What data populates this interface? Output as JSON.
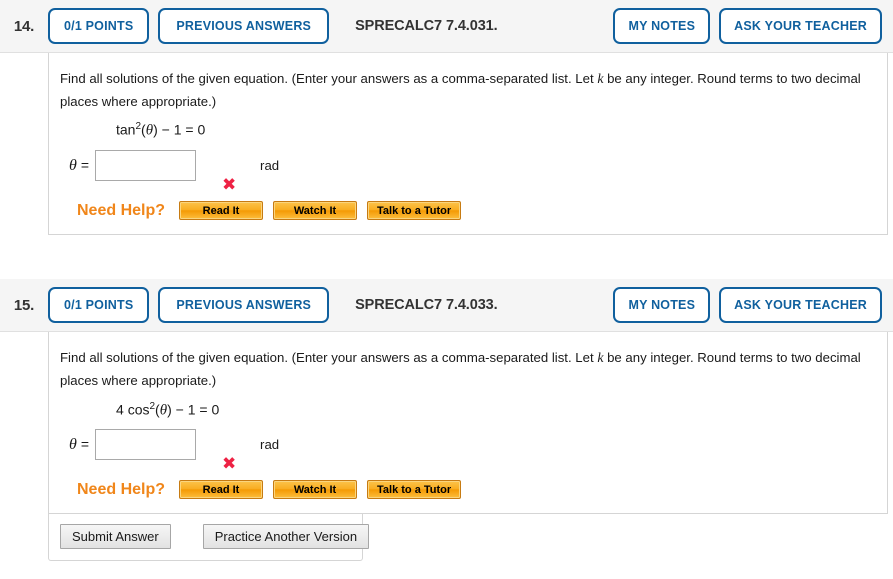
{
  "questions": [
    {
      "number": "14.",
      "points_label": "0/1 POINTS",
      "previous_answers_label": "PREVIOUS ANSWERS",
      "code": "SPRECALC7 7.4.031.",
      "my_notes_label": "MY NOTES",
      "ask_teacher_label": "ASK YOUR TEACHER",
      "prompt_part1": "Find all solutions of the given equation. (Enter your answers as a comma-separated list. Let ",
      "prompt_var": "k",
      "prompt_part2": " be any integer. Round terms to two decimal places where appropriate.)",
      "equation": {
        "func": "tan",
        "exponent": "2",
        "arg": "θ",
        "rest": " − 1 = 0",
        "coefficient": ""
      },
      "answer_var": "θ",
      "answer_equals": "=",
      "answer_value": "",
      "answer_placeholder": "",
      "unit_label": "rad",
      "mark": "✖",
      "mark_status": "incorrect",
      "need_help_label": "Need Help?",
      "help_buttons": [
        "Read It",
        "Watch It",
        "Talk to a Tutor"
      ]
    },
    {
      "number": "15.",
      "points_label": "0/1 POINTS",
      "previous_answers_label": "PREVIOUS ANSWERS",
      "code": "SPRECALC7 7.4.033.",
      "my_notes_label": "MY NOTES",
      "ask_teacher_label": "ASK YOUR TEACHER",
      "prompt_part1": "Find all solutions of the given equation. (Enter your answers as a comma-separated list. Let ",
      "prompt_var": "k",
      "prompt_part2": " be any integer. Round terms to two decimal places where appropriate.)",
      "equation": {
        "coefficient": "4 ",
        "func": "cos",
        "exponent": "2",
        "arg": "θ",
        "rest": " − 1 = 0"
      },
      "answer_var": "θ",
      "answer_equals": "=",
      "answer_value": "",
      "answer_placeholder": "",
      "unit_label": "rad",
      "mark": "✖",
      "mark_status": "incorrect",
      "need_help_label": "Need Help?",
      "help_buttons": [
        "Read It",
        "Watch It",
        "Talk to a Tutor"
      ]
    }
  ],
  "submit_row": {
    "submit_label": "Submit Answer",
    "practice_label": "Practice Another Version"
  },
  "colors": {
    "accent_blue": "#10609e",
    "help_orange": "#f0861a",
    "incorrect_red": "#ee2244",
    "header_bg": "#f5f5f5"
  }
}
